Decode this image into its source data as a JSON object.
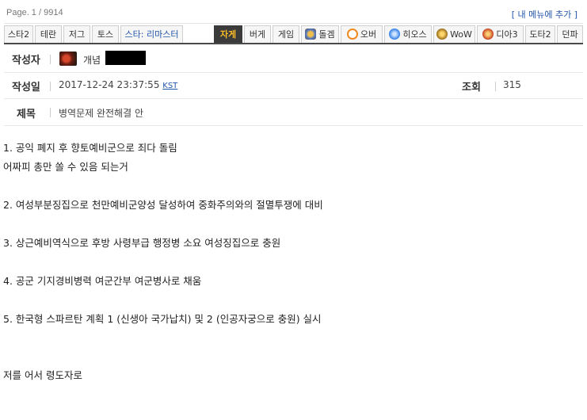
{
  "header": {
    "page_info": "Page. 1 / 9914",
    "my_menu_label": "[ 내 메뉴에 추가 ]"
  },
  "tabs": [
    {
      "label": "스타2",
      "style": "normal"
    },
    {
      "label": "테란",
      "style": "normal"
    },
    {
      "label": "저그",
      "style": "normal"
    },
    {
      "label": "토스",
      "style": "normal"
    },
    {
      "label": "스타: 리마스터",
      "style": "blue"
    },
    {
      "label": "자게",
      "style": "active"
    },
    {
      "label": "버게",
      "style": "normal"
    },
    {
      "label": "게임",
      "style": "normal"
    },
    {
      "label": "돌겜",
      "style": "normal",
      "icon": "hearthstone-icon"
    },
    {
      "label": "오버",
      "style": "normal",
      "icon": "overwatch-icon"
    },
    {
      "label": "히오스",
      "style": "normal",
      "icon": "heroes-icon"
    },
    {
      "label": "WoW",
      "style": "normal",
      "icon": "wow-icon"
    },
    {
      "label": "디아3",
      "style": "normal",
      "icon": "diablo-icon"
    },
    {
      "label": "도타2",
      "style": "normal"
    },
    {
      "label": "던파",
      "style": "normal"
    }
  ],
  "post": {
    "author_label": "작성자",
    "author_name": "개념",
    "date_label": "작성일",
    "date_value": "2017-12-24 23:37:55",
    "timezone": "KST",
    "views_label": "조회",
    "views_value": "315",
    "title_label": "제목",
    "title_value": "병역문제 완전해결 안"
  },
  "body_lines": [
    "1. 공익 폐지 후 향토예비군으로 죄다 돌림",
    "어짜피 총만 쏠 수 있음 되는거",
    "2. 여성부분징집으로 천만예비군양성 달성하여 중화주의와의 절멸투쟁에 대비",
    "3. 상근예비역식으로 후방 사령부급 행정병 소요 여성징집으로 충원",
    "4. 공군 기지경비병력 여군간부 여군병사로 채움",
    "5. 한국형 스파르탄 계획 1 (신생아 국가납치) 및 2 (인공자궁으로 충원) 실시",
    "저를 어서 령도자로"
  ]
}
